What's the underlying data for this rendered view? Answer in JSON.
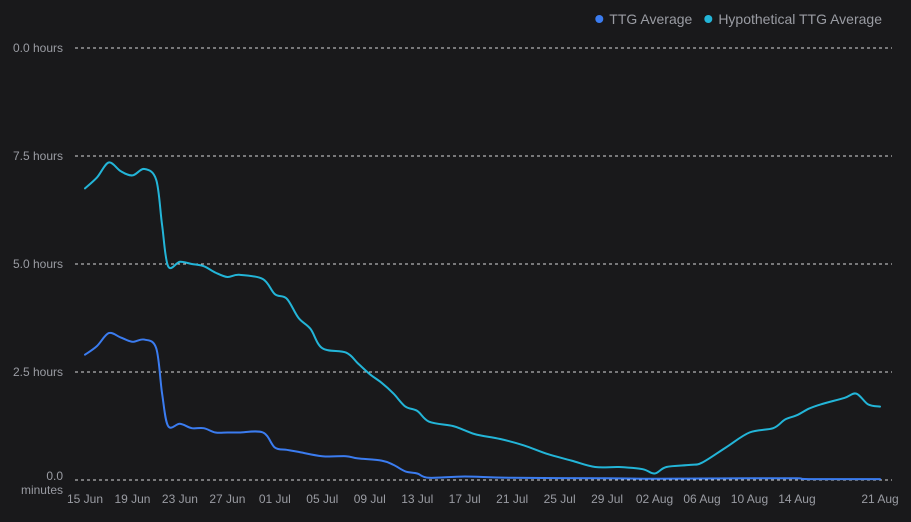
{
  "chart_data": {
    "type": "line",
    "title": "",
    "xlabel": "",
    "ylabel": "",
    "ylim": [
      0,
      10
    ],
    "y_ticks": [
      {
        "value": 0,
        "label": "0.0 minutes"
      },
      {
        "value": 2.5,
        "label": "2.5 hours"
      },
      {
        "value": 5.0,
        "label": "5.0 hours"
      },
      {
        "value": 7.5,
        "label": "7.5 hours"
      },
      {
        "value": 10.0,
        "label": "0.0 hours"
      }
    ],
    "x_ticks": [
      "15 Jun",
      "19 Jun",
      "23 Jun",
      "27 Jun",
      "01 Jul",
      "05 Jul",
      "09 Jul",
      "13 Jul",
      "17 Jul",
      "21 Jul",
      "25 Jul",
      "29 Jul",
      "02 Aug",
      "06 Aug",
      "10 Aug",
      "14 Aug",
      "21 Aug"
    ],
    "grid": true,
    "legend_position": "top-right",
    "series": [
      {
        "name": "TTG Average",
        "color": "#3b7cf0",
        "points": [
          [
            "15 Jun",
            2.9
          ],
          [
            "16 Jun",
            3.1
          ],
          [
            "17 Jun",
            3.4
          ],
          [
            "18 Jun",
            3.3
          ],
          [
            "19 Jun",
            3.2
          ],
          [
            "20 Jun",
            3.25
          ],
          [
            "21 Jun",
            3.05
          ],
          [
            "21.5 Jun",
            2.0
          ],
          [
            "22 Jun",
            1.25
          ],
          [
            "23 Jun",
            1.3
          ],
          [
            "24 Jun",
            1.2
          ],
          [
            "25 Jun",
            1.2
          ],
          [
            "26 Jun",
            1.1
          ],
          [
            "27 Jun",
            1.1
          ],
          [
            "28 Jun",
            1.1
          ],
          [
            "30 Jun",
            1.1
          ],
          [
            "01 Jul",
            0.75
          ],
          [
            "02 Jul",
            0.7
          ],
          [
            "03 Jul",
            0.65
          ],
          [
            "05 Jul",
            0.55
          ],
          [
            "07 Jul",
            0.55
          ],
          [
            "08 Jul",
            0.5
          ],
          [
            "10 Jul",
            0.45
          ],
          [
            "11 Jul",
            0.35
          ],
          [
            "12 Jul",
            0.2
          ],
          [
            "13 Jul",
            0.15
          ],
          [
            "14 Jul",
            0.05
          ],
          [
            "17 Jul",
            0.08
          ],
          [
            "21 Jul",
            0.05
          ],
          [
            "29 Jul",
            0.04
          ],
          [
            "02 Aug",
            0.03
          ],
          [
            "10 Aug",
            0.04
          ],
          [
            "14 Aug",
            0.04
          ],
          [
            "15 Aug",
            0.02
          ],
          [
            "21 Aug",
            0.02
          ]
        ]
      },
      {
        "name": "Hypothetical TTG Average",
        "color": "#23b5d8",
        "points": [
          [
            "15 Jun",
            6.75
          ],
          [
            "16 Jun",
            7.0
          ],
          [
            "17 Jun",
            7.35
          ],
          [
            "18 Jun",
            7.15
          ],
          [
            "19 Jun",
            7.05
          ],
          [
            "20 Jun",
            7.2
          ],
          [
            "21 Jun",
            6.95
          ],
          [
            "21.5 Jun",
            5.9
          ],
          [
            "22 Jun",
            4.95
          ],
          [
            "23 Jun",
            5.05
          ],
          [
            "24 Jun",
            5.0
          ],
          [
            "25 Jun",
            4.95
          ],
          [
            "26 Jun",
            4.8
          ],
          [
            "27 Jun",
            4.7
          ],
          [
            "28 Jun",
            4.75
          ],
          [
            "30 Jun",
            4.65
          ],
          [
            "01 Jul",
            4.3
          ],
          [
            "02 Jul",
            4.2
          ],
          [
            "03 Jul",
            3.75
          ],
          [
            "04 Jul",
            3.5
          ],
          [
            "05 Jul",
            3.05
          ],
          [
            "07 Jul",
            2.95
          ],
          [
            "08 Jul",
            2.7
          ],
          [
            "09 Jul",
            2.45
          ],
          [
            "10 Jul",
            2.25
          ],
          [
            "11 Jul",
            2.0
          ],
          [
            "12 Jul",
            1.7
          ],
          [
            "13 Jul",
            1.6
          ],
          [
            "14 Jul",
            1.35
          ],
          [
            "16 Jul",
            1.25
          ],
          [
            "17 Jul",
            1.15
          ],
          [
            "18 Jul",
            1.05
          ],
          [
            "20 Jul",
            0.95
          ],
          [
            "22 Jul",
            0.8
          ],
          [
            "24 Jul",
            0.6
          ],
          [
            "26 Jul",
            0.45
          ],
          [
            "28 Jul",
            0.3
          ],
          [
            "30 Jul",
            0.3
          ],
          [
            "01 Aug",
            0.25
          ],
          [
            "02 Aug",
            0.15
          ],
          [
            "03 Aug",
            0.3
          ],
          [
            "05 Aug",
            0.35
          ],
          [
            "06 Aug",
            0.4
          ],
          [
            "08 Aug",
            0.75
          ],
          [
            "10 Aug",
            1.1
          ],
          [
            "12 Aug",
            1.2
          ],
          [
            "13 Aug",
            1.4
          ],
          [
            "14 Aug",
            1.5
          ],
          [
            "15 Aug",
            1.65
          ],
          [
            "16 Aug",
            1.75
          ],
          [
            "18 Aug",
            1.9
          ],
          [
            "19 Aug",
            2.0
          ],
          [
            "20 Aug",
            1.75
          ],
          [
            "21 Aug",
            1.7
          ]
        ]
      }
    ]
  }
}
